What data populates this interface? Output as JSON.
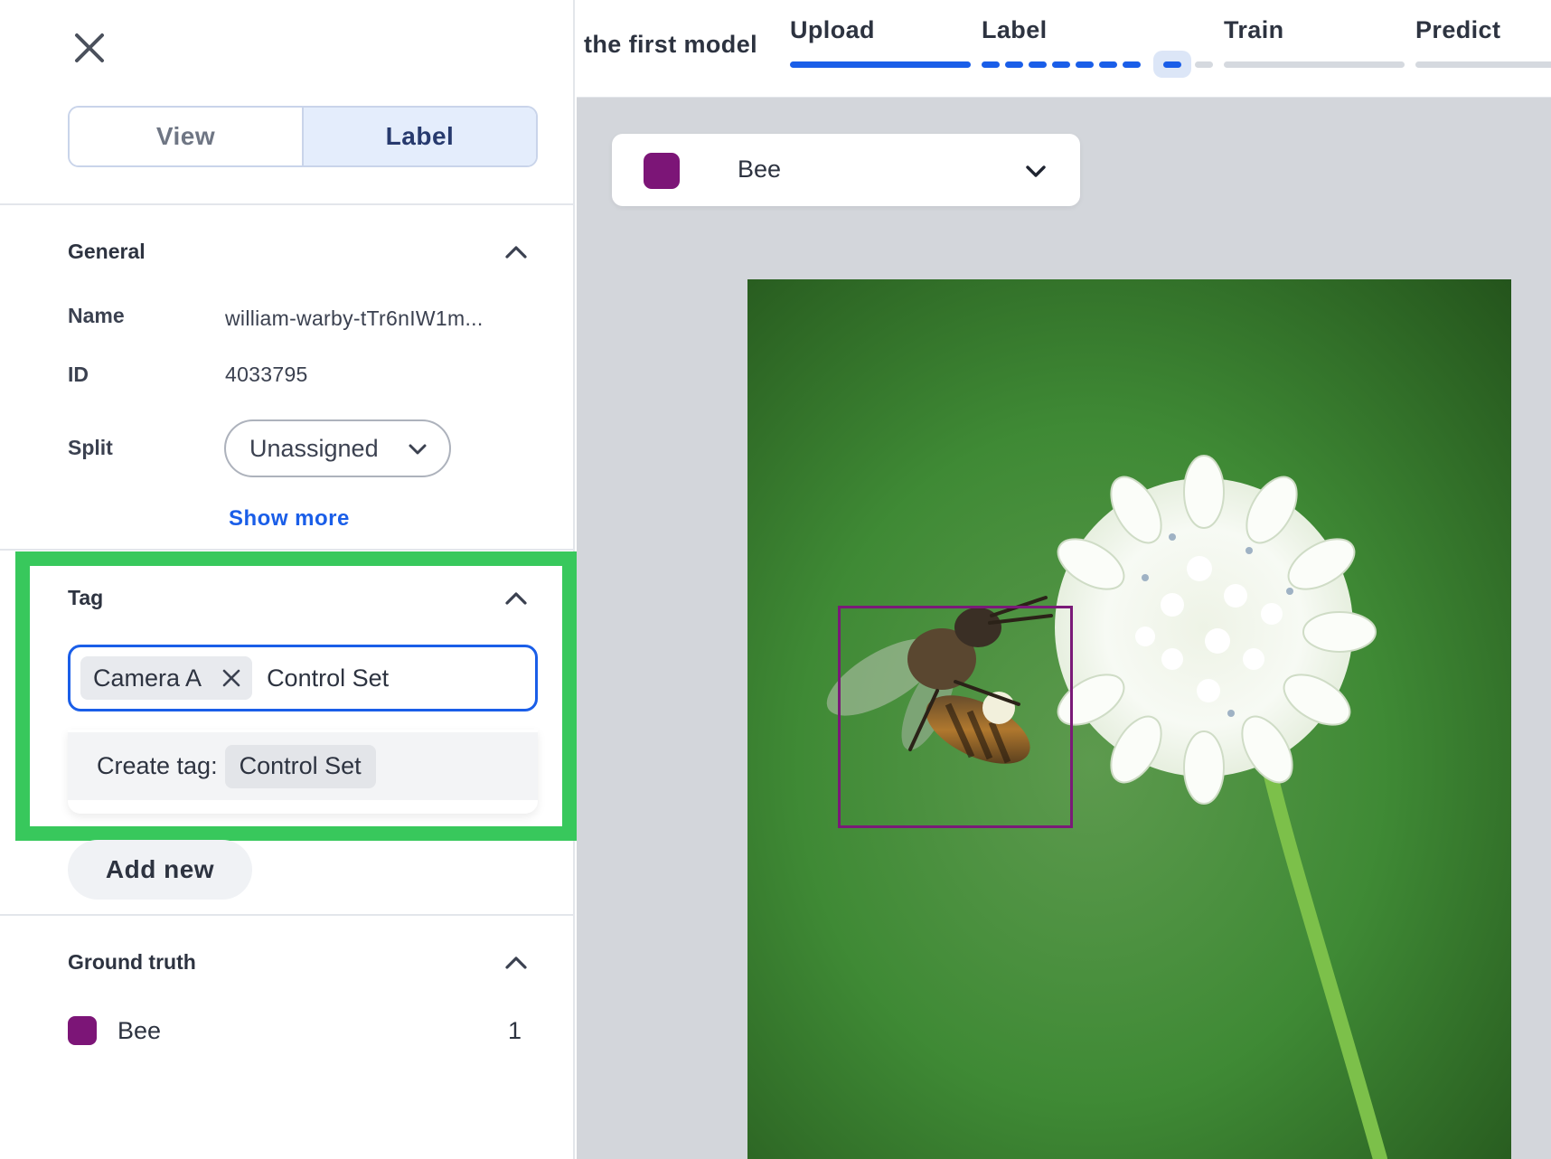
{
  "left_panel": {
    "mode_tabs": {
      "view": "View",
      "label": "Label",
      "active": "Label"
    },
    "general": {
      "title": "General",
      "name_label": "Name",
      "name_value": "william-warby-tTr6nIW1m...",
      "id_label": "ID",
      "id_value": "4033795",
      "split_label": "Split",
      "split_value": "Unassigned",
      "show_more": "Show more"
    },
    "tag": {
      "title": "Tag",
      "chips": [
        "Camera A"
      ],
      "input_value": "Control Set",
      "dropdown_prefix": "Create tag:",
      "dropdown_tag": "Control Set",
      "add_new": "Add new"
    },
    "ground_truth": {
      "title": "Ground truth",
      "items": [
        {
          "name": "Bee",
          "count": "1",
          "color": "#7c1577"
        }
      ]
    }
  },
  "top_bar": {
    "project_name": "the first model",
    "steps": [
      {
        "label": "Upload",
        "state": "complete"
      },
      {
        "label": "Label",
        "state": "in-progress"
      },
      {
        "label": "Train",
        "state": "pending"
      },
      {
        "label": "Predict",
        "state": "pending"
      }
    ]
  },
  "canvas": {
    "class_select": {
      "name": "Bee",
      "color": "#7c1577"
    },
    "annotation": {
      "class": "Bee",
      "color": "#7a1a78"
    }
  },
  "colors": {
    "accent": "#1a5ee8",
    "highlight": "#38c85c",
    "bee_class": "#7c1577"
  }
}
